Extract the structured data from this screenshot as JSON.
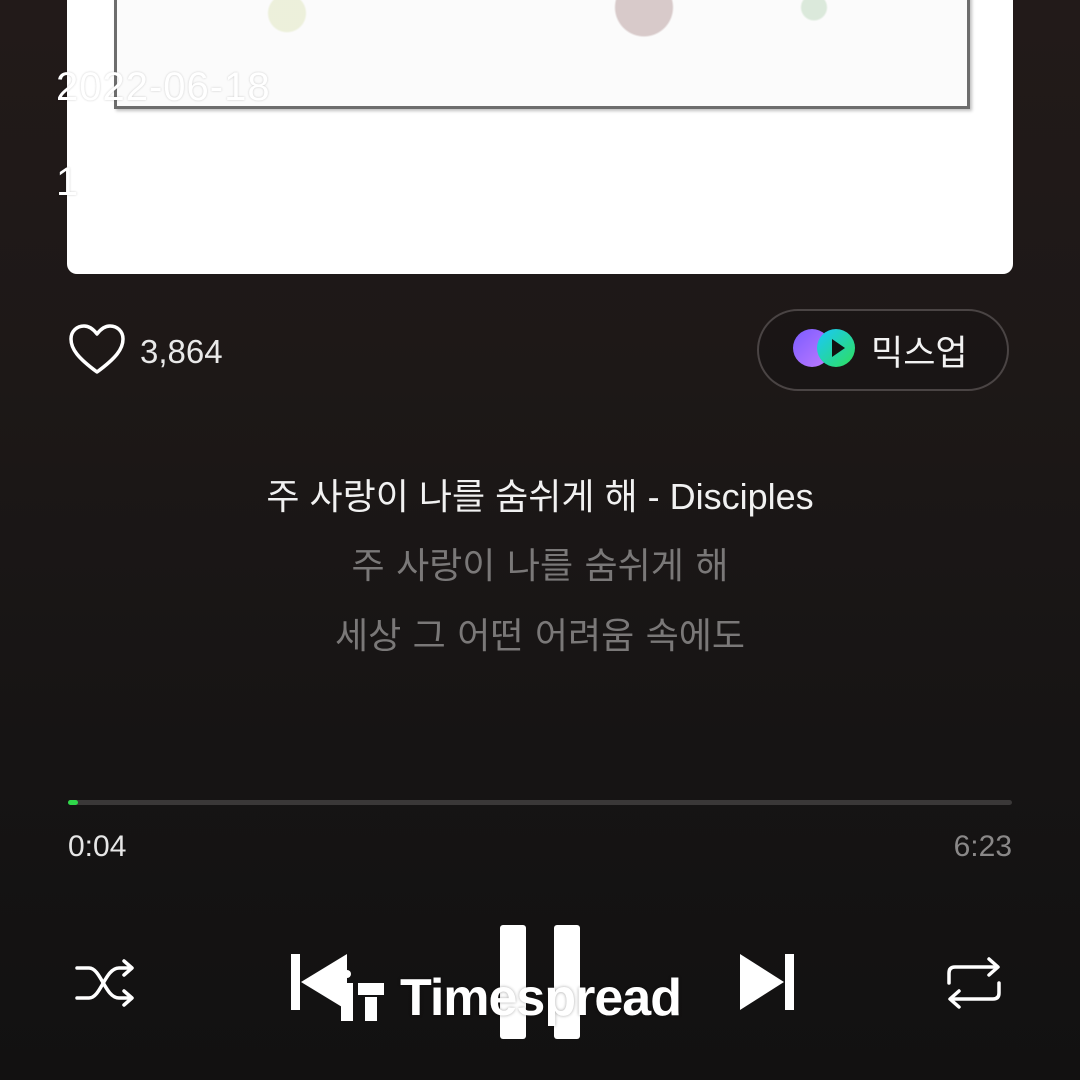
{
  "overlay": {
    "date": "2022-06-18",
    "time": "1"
  },
  "likes": {
    "count": "3,864",
    "icon": "heart-outline-icon"
  },
  "mixup": {
    "label": "믹스업",
    "icon": "mixup-logo-icon"
  },
  "lyrics": {
    "current": "주 사랑이 나를 숨쉬게 해 - Disciples",
    "next_lines": [
      "주 사랑이 나를 숨쉬게 해",
      "세상 그 어떤 어려움 속에도"
    ]
  },
  "playback": {
    "elapsed": "0:04",
    "total": "6:23",
    "progress_fraction": 0.0104,
    "accent_color": "#2fd74a"
  },
  "controls": {
    "shuffle_icon": "shuffle-icon",
    "prev_icon": "skip-previous-icon",
    "pause_icon": "pause-icon",
    "next_icon": "skip-next-icon",
    "repeat_icon": "repeat-icon"
  },
  "watermark": {
    "text": "Timespread"
  }
}
